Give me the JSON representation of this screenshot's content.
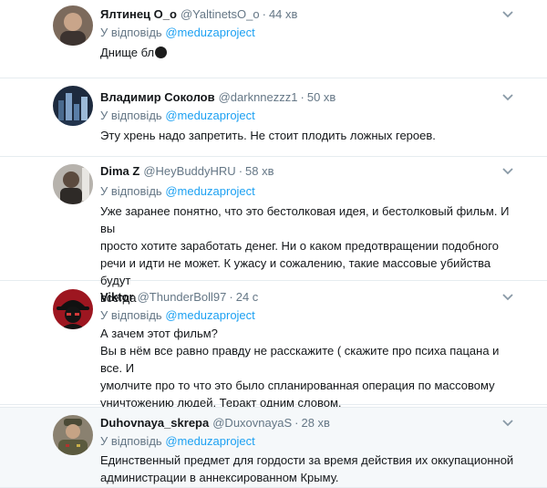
{
  "reply_prefix": "У відповідь",
  "tweets": [
    {
      "name": "Ялтинец О_о",
      "handle": "@YaltinetsO_o",
      "time": "44 хв",
      "mention": "@meduzaproject",
      "lines": [
        "Днище бл"
      ],
      "avatar": "avatar-photo-man"
    },
    {
      "name": "Владимир Соколов",
      "handle": "@darknnezzz1",
      "time": "50 хв",
      "mention": "@meduzaproject",
      "lines": [
        "Эту хрень надо запретить.  Не стоит плодить ложных героев."
      ],
      "avatar": "avatar-city-skyline"
    },
    {
      "name": "Dima Z",
      "handle": "@HeyBuddyHRU",
      "time": "58 хв",
      "mention": "@meduzaproject",
      "lines": [
        "Уже заранее понятно, что это бестолковая идея, и бестолковый фильм. И вы",
        "просто хотите заработать денег. Ни о каком предотвращении подобного",
        "речи и идти не может. К ужасу и сожалению, такие массовые убийства будут",
        "всегда"
      ],
      "avatar": "avatar-photo-person"
    },
    {
      "name": "Viktor",
      "handle": "@ThunderBoll97",
      "time": "24 с",
      "mention": "@meduzaproject",
      "lines": [
        "А зачем этот фильм?",
        "Вы в нём все равно правду не расскажите ( скажите про психа пацана и все. И",
        "умолчите про то что это было спланированная операция по массовому",
        "уничтожению людей. Теракт одним словом."
      ],
      "avatar": "avatar-hacker-red"
    },
    {
      "name": "Duhovnaya_skrepa",
      "handle": "@DuxovnayaS",
      "time": "28 хв",
      "mention": "@meduzaproject",
      "lines": [
        "Единственный предмет для гордости за время действия  их оккупационной",
        "администрации в аннексированном Крыму."
      ],
      "avatar": "avatar-photo-officer"
    }
  ]
}
